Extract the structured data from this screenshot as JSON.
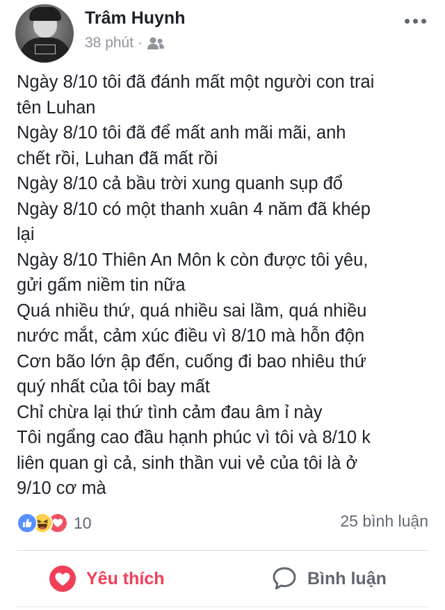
{
  "post": {
    "author": "Trâm Huynh",
    "time": "38 phút",
    "separator": "·",
    "audience_icon": "friends-icon",
    "more_icon": "more-icon",
    "text_lines": [
      "Ngày 8/10 tôi đã đánh mất một người con trai",
      "tên Luhan",
      "Ngày 8/10 tôi đã để mất anh mãi mãi, anh",
      "chết rồi, Luhan đã mất rồi",
      "Ngày 8/10 cả bầu trời xung quanh sụp đổ",
      "Ngày 8/10 có một thanh xuân 4 năm đã khép",
      "lại",
      "Ngày 8/10 Thiên An Môn k còn được tôi yêu,",
      "gửi gấm niềm tin nữa",
      "Quá nhiều thứ, quá nhiều sai lầm, quá nhiều",
      "nước mắt, cảm xúc điều vì 8/10 mà hỗn độn",
      "Cơn bão lớn ập đến, cuống đi bao nhiêu thứ",
      "quý nhất của tôi bay mất",
      "Chỉ chừa lại thứ tình cảm đau âm ỉ này",
      "Tôi ngẩng cao đầu hạnh phúc vì tôi và 8/10 k",
      "liên quan gì cả, sinh thần vui vẻ của tôi là ở",
      "9/10 cơ mà"
    ]
  },
  "reactions": {
    "icons": [
      "like-icon",
      "haha-icon",
      "love-icon"
    ],
    "count": "10",
    "comments": "25 bình luận"
  },
  "actions": {
    "like_label": "Yêu thích",
    "comment_label": "Bình luận"
  },
  "colors": {
    "text": "#1d2129",
    "muted": "#90949c",
    "like_blue": "#5890ff",
    "haha_yellow": "#fcd04b",
    "love_red": "#f33e58"
  }
}
